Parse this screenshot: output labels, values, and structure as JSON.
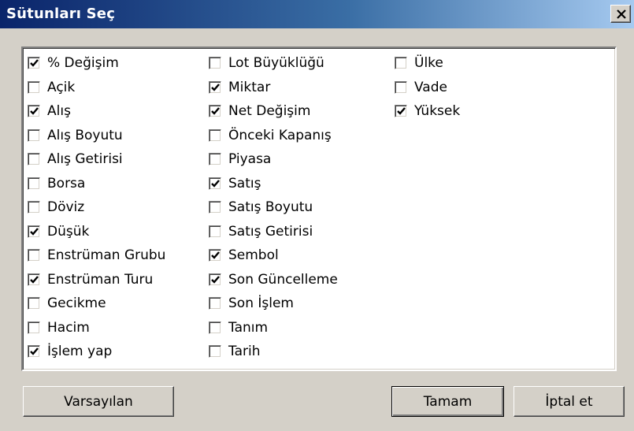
{
  "window": {
    "title": "Sütunları Seç",
    "close_glyph": "close-x-icon"
  },
  "columns": [
    [
      {
        "label": "% Değişim",
        "checked": true
      },
      {
        "label": "Açik",
        "checked": false
      },
      {
        "label": "Alış",
        "checked": true
      },
      {
        "label": "Alış Boyutu",
        "checked": false
      },
      {
        "label": "Alış Getirisi",
        "checked": false
      },
      {
        "label": "Borsa",
        "checked": false
      },
      {
        "label": "Döviz",
        "checked": false
      },
      {
        "label": "Düşük",
        "checked": true
      },
      {
        "label": "Enstrüman Grubu",
        "checked": false
      },
      {
        "label": "Enstrüman Turu",
        "checked": true
      },
      {
        "label": "Gecikme",
        "checked": false
      },
      {
        "label": "Hacim",
        "checked": false
      },
      {
        "label": "İşlem yap",
        "checked": true
      }
    ],
    [
      {
        "label": "Lot Büyüklüğü",
        "checked": false
      },
      {
        "label": "Miktar",
        "checked": true
      },
      {
        "label": "Net Değişim",
        "checked": true
      },
      {
        "label": "Önceki Kapanış",
        "checked": false
      },
      {
        "label": "Piyasa",
        "checked": false
      },
      {
        "label": "Satış",
        "checked": true
      },
      {
        "label": "Satış Boyutu",
        "checked": false
      },
      {
        "label": "Satış Getirisi",
        "checked": false
      },
      {
        "label": "Sembol",
        "checked": true
      },
      {
        "label": "Son Güncelleme",
        "checked": true
      },
      {
        "label": "Son İşlem",
        "checked": false
      },
      {
        "label": "Tanım",
        "checked": false
      },
      {
        "label": "Tarih",
        "checked": false
      }
    ],
    [
      {
        "label": "Ülke",
        "checked": false
      },
      {
        "label": "Vade",
        "checked": false
      },
      {
        "label": "Yüksek",
        "checked": true
      }
    ]
  ],
  "buttons": {
    "default_label": "Varsayılan",
    "ok_label": "Tamam",
    "cancel_label": "İptal et"
  }
}
